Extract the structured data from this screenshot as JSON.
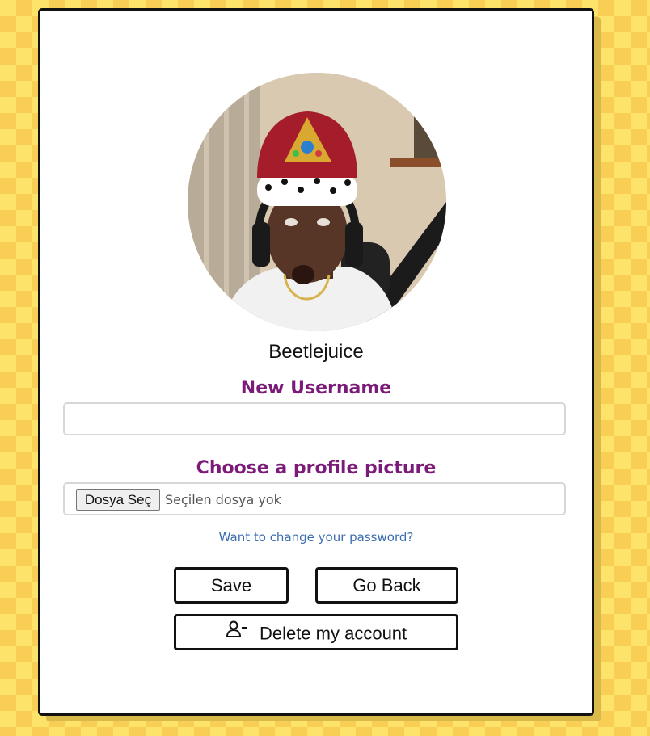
{
  "profile": {
    "display_name": "Beetlejuice",
    "avatar": "profile-photo"
  },
  "form": {
    "username_label": "New Username",
    "username_value": "",
    "picture_label": "Choose a profile picture",
    "file_button_label": "Dosya Seç",
    "file_status": "Seçilen dosya yok",
    "password_link": "Want to change your password?"
  },
  "actions": {
    "save_label": "Save",
    "back_label": "Go Back",
    "delete_label": "Delete my account",
    "delete_icon": "user-minus-icon"
  },
  "colors": {
    "label": "#7b1a79",
    "link": "#3a6db0",
    "background": "#fde36a"
  }
}
